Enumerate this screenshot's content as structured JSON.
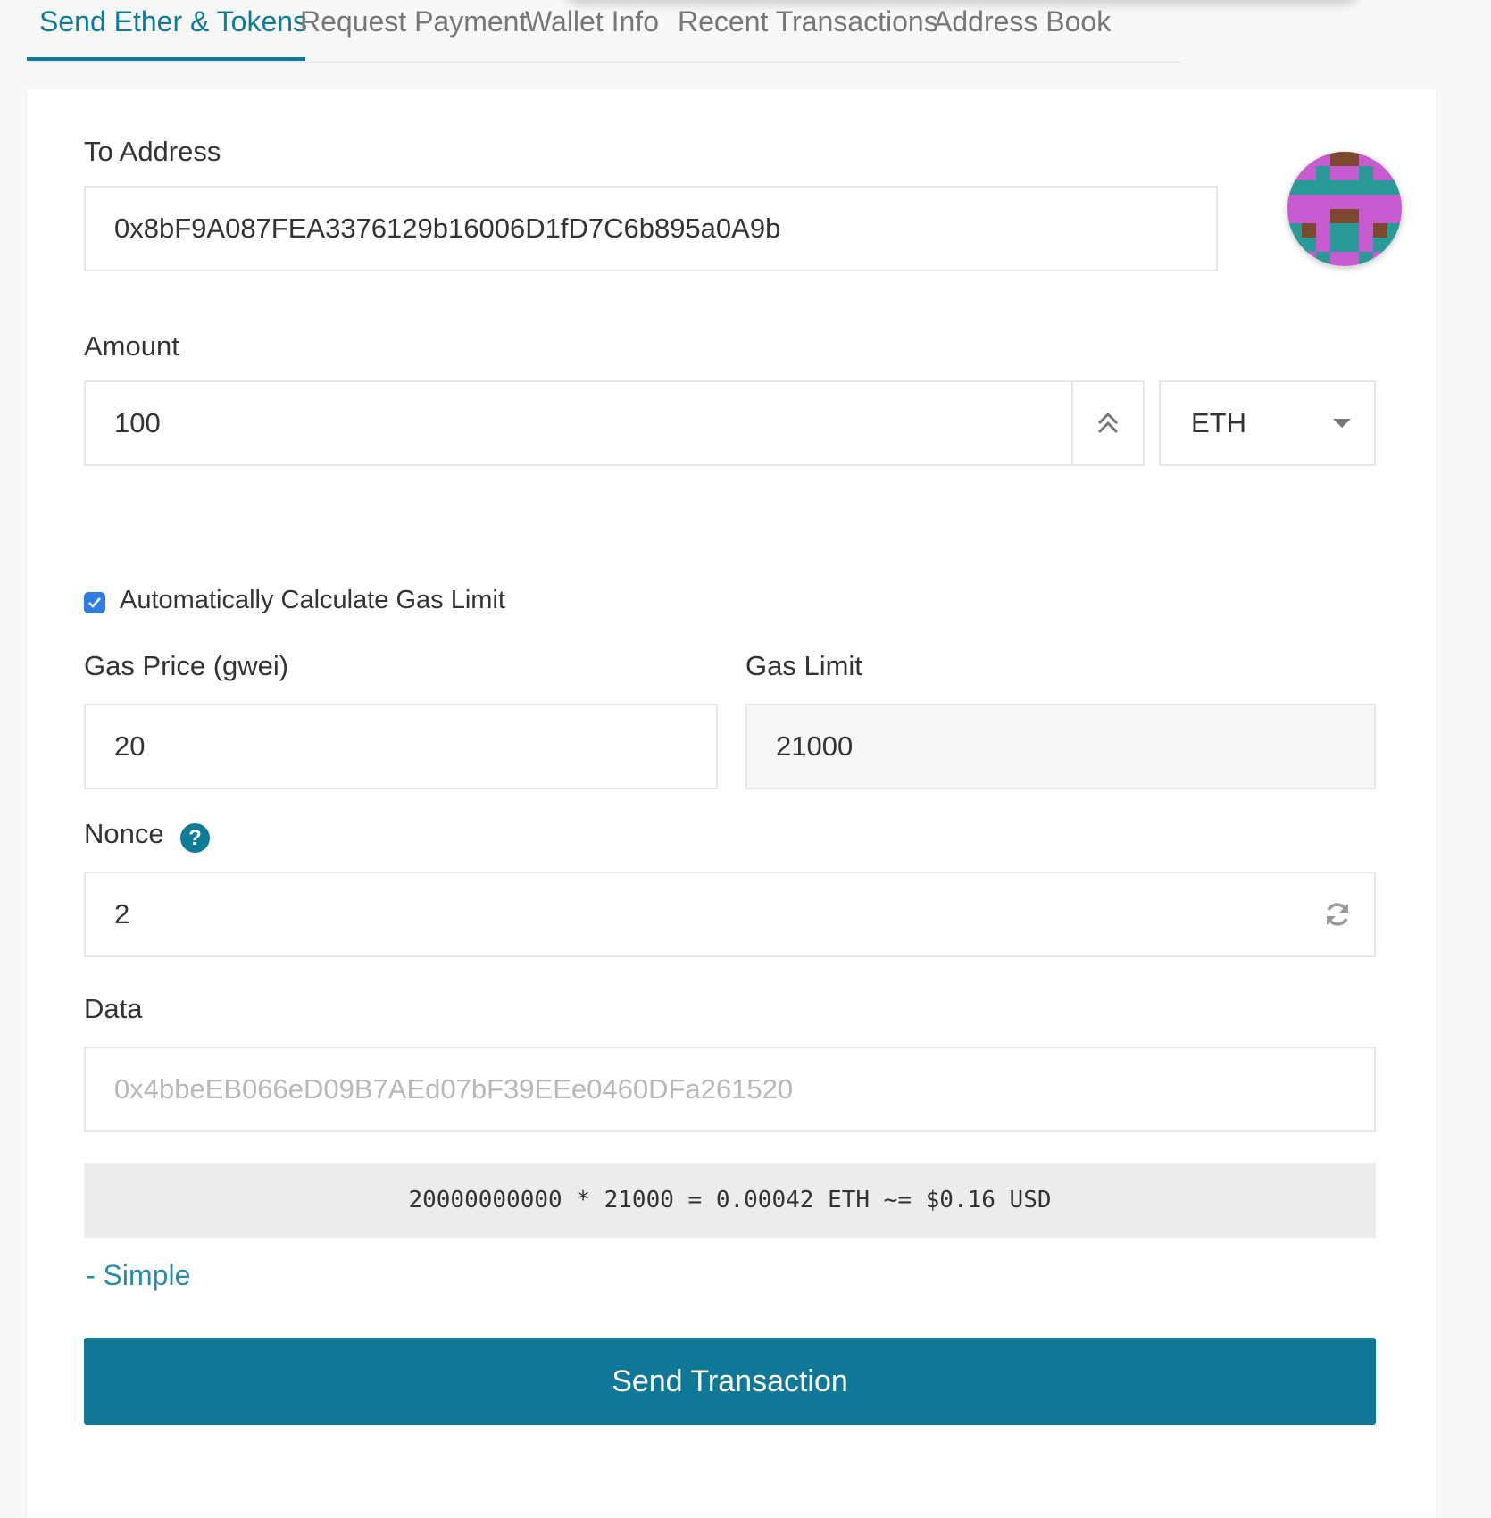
{
  "tabs": [
    {
      "label": "Send Ether & Tokens",
      "active": true
    },
    {
      "label": "Request Payment",
      "active": false
    },
    {
      "label": "Wallet Info",
      "active": false
    },
    {
      "label": "Recent Transactions",
      "active": false
    },
    {
      "label": "Address Book",
      "active": false
    }
  ],
  "form": {
    "to_address": {
      "label": "To Address",
      "value": "0x8bF9A087FEA3376129b16006D1fD7C6b895a0A9b"
    },
    "amount": {
      "label": "Amount",
      "value": "100",
      "unit": "ETH"
    },
    "auto_gas": {
      "label": "Automatically Calculate Gas Limit",
      "checked": true
    },
    "gas_price": {
      "label": "Gas Price (gwei)",
      "value": "20"
    },
    "gas_limit": {
      "label": "Gas Limit",
      "value": "21000"
    },
    "nonce": {
      "label": "Nonce",
      "value": "2",
      "help_icon": "?"
    },
    "data": {
      "label": "Data",
      "placeholder": "0x4bbeEB066eD09B7AEd07bF39EEe0460DFa261520"
    }
  },
  "cost_summary": "20000000000 * 21000 = 0.00042 ETH ~= $0.16 USD",
  "simple_link": "- Simple",
  "send_button": "Send Transaction",
  "colors": {
    "accent": "#0e7c99",
    "button": "#0e7896",
    "checkbox": "#2f7de0"
  },
  "icons": {
    "identicon": "identicon-avatar",
    "amount_spinner": "double-chevron-up-icon",
    "unit_dropdown": "caret-down-icon",
    "nonce_help": "question-circle-icon",
    "nonce_refresh": "refresh-icon"
  }
}
